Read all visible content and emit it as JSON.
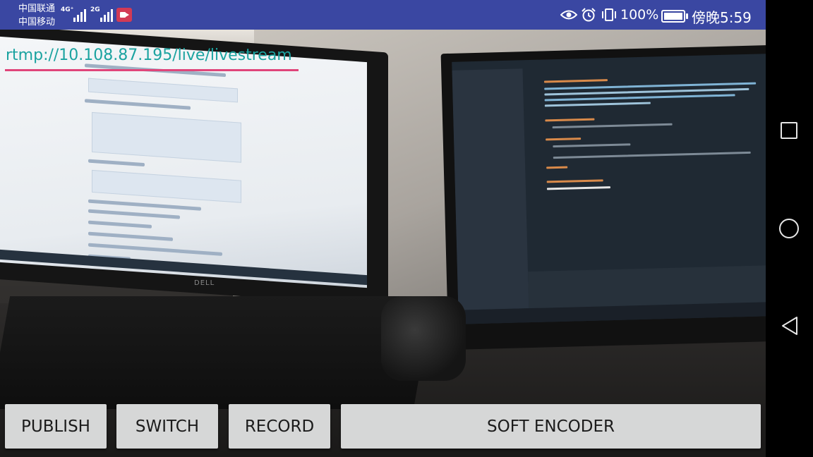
{
  "status_bar": {
    "carrier_1": "中国联通",
    "carrier_2": "中国移动",
    "network_1": "4G⁺",
    "network_2": "2G",
    "battery_percent": "100%",
    "time": "傍晚5:59",
    "icons": [
      "screen-record-icon",
      "eye-icon",
      "alarm-icon",
      "vibrate-icon",
      "battery-icon"
    ]
  },
  "overlay": {
    "rtmp_url": "rtmp://10.108.87.195/live/livestream",
    "url_color": "#1ba3a0",
    "underline_color": "#e0457a"
  },
  "buttons": {
    "publish": "PUBLISH",
    "switch": "SWITCH",
    "record": "RECORD",
    "encoder": "SOFT ENCODER"
  },
  "laptop_brand": "DELL",
  "nav_bar": {
    "icons": [
      "recents-square-icon",
      "home-circle-icon",
      "back-triangle-icon"
    ]
  },
  "colors": {
    "status_bar": "#3a47a2",
    "button_bg": "#d6d7d7"
  }
}
